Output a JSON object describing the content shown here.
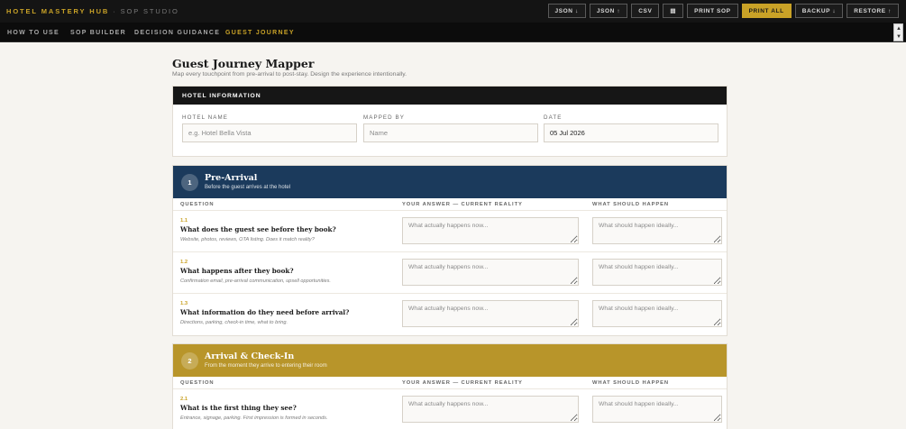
{
  "app": {
    "brand": "HOTEL MASTERY HUB",
    "brand_suffix": "· SOP STUDIO"
  },
  "toolbar": {
    "buttons": [
      "JSON ↓",
      "JSON ↑",
      "CSV",
      "▤",
      "PRINT SOP",
      "PRINT ALL",
      "BACKUP ↓",
      "RESTORE ↑"
    ],
    "accent": "#c9a227"
  },
  "nav": {
    "tabs": [
      "HOW TO USE",
      "SOP BUILDER",
      "DECISION GUIDANCE",
      "GUEST JOURNEY"
    ],
    "active": "GUEST JOURNEY"
  },
  "page": {
    "title": "Guest Journey Mapper",
    "subtitle": "Map every touchpoint from pre-arrival to post-stay. Design the experience intentionally."
  },
  "hotel": {
    "header": "HOTEL INFORMATION",
    "fields": [
      {
        "label": "HOTEL NAME",
        "value": "",
        "placeholder": "e.g. Hotel Bella Vista"
      },
      {
        "label": "MAPPED BY",
        "value": "",
        "placeholder": "Name"
      },
      {
        "label": "DATE",
        "value": "05 Jul 2026",
        "placeholder": ""
      }
    ]
  },
  "columns": {
    "question": "QUESTION",
    "current": "YOUR ANSWER — CURRENT REALITY",
    "ideal": "WHAT SHOULD HAPPEN"
  },
  "placeholders": {
    "current": "What actually happens now...",
    "ideal": "What should happen ideally..."
  },
  "sections": [
    {
      "num": "1",
      "title": "Pre-Arrival",
      "subtitle": "Before the guest arrives at the hotel",
      "color": "#1b3a5c",
      "questions": [
        {
          "id": "1.1",
          "text": "What does the guest see before they book?",
          "hint": "Website, photos, reviews, OTA listing. Does it match reality?"
        },
        {
          "id": "1.2",
          "text": "What happens after they book?",
          "hint": "Confirmation email, pre-arrival communication, upsell opportunities."
        },
        {
          "id": "1.3",
          "text": "What information do they need before arrival?",
          "hint": "Directions, parking, check-in time, what to bring."
        }
      ]
    },
    {
      "num": "2",
      "title": "Arrival & Check-In",
      "subtitle": "From the moment they arrive to entering their room",
      "color": "#b8952a",
      "questions": [
        {
          "id": "2.1",
          "text": "What is the first thing they see?",
          "hint": "Entrance, signage, parking. First impression is formed in seconds."
        }
      ]
    }
  ]
}
